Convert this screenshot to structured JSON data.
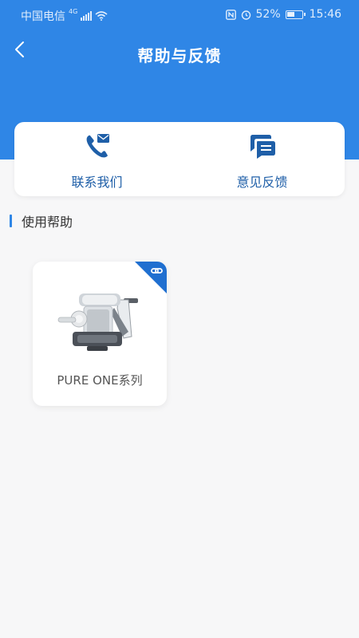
{
  "status_bar": {
    "carrier": "中国电信",
    "network": "4G",
    "battery": "52%",
    "time": "15:46"
  },
  "header": {
    "title": "帮助与反馈"
  },
  "actions": [
    {
      "label": "联系我们",
      "icon": "phone-mail-icon"
    },
    {
      "label": "意见反馈",
      "icon": "chat-bubble-icon"
    }
  ],
  "section": {
    "title": "使用帮助"
  },
  "products": [
    {
      "name": "PURE ONE系列",
      "badge_icon": "link-icon",
      "image": "vacuum-product-image"
    }
  ],
  "colors": {
    "primary": "#2f86e6",
    "action_text": "#1f5fa8",
    "background": "#f7f7f8"
  }
}
